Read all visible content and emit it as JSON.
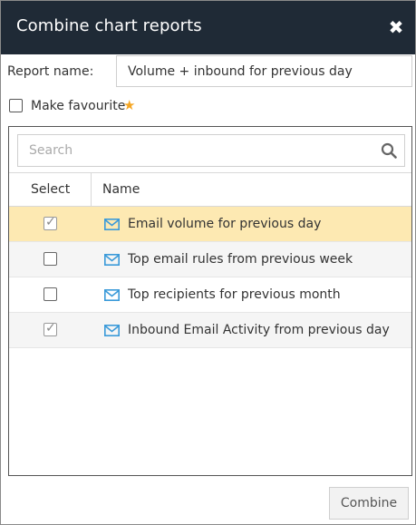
{
  "dialog": {
    "title": "Combine chart reports",
    "close_glyph": "✖"
  },
  "form": {
    "report_name_label": "Report name:",
    "report_name_value": "Volume + inbound for previous day",
    "favourite_label": "Make favourite",
    "favourite_checked": false
  },
  "list": {
    "search_placeholder": "Search",
    "columns": {
      "select": "Select",
      "name": "Name"
    },
    "rows": [
      {
        "name": "Email volume for previous day",
        "checked": true
      },
      {
        "name": "Top email rules from previous week",
        "checked": false
      },
      {
        "name": "Top recipients for previous month",
        "checked": false
      },
      {
        "name": "Inbound Email Activity from previous day",
        "checked": true
      }
    ]
  },
  "footer": {
    "combine_label": "Combine"
  },
  "colors": {
    "titlebar": "#1f2a36",
    "selected_row": "#fde9b2",
    "accent_icon": "#3a9ad9",
    "star": "#f5a623"
  },
  "icons": {
    "close": "close-icon",
    "favourite": "star-icon",
    "search": "search-icon",
    "row_type": "envelope-icon"
  }
}
